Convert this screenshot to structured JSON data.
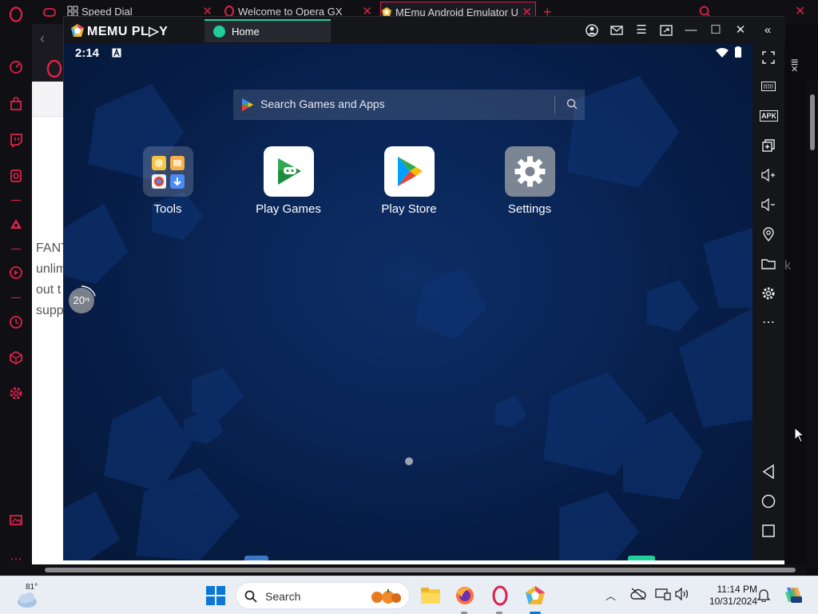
{
  "browser": {
    "tabs": [
      {
        "label": "Speed Dial"
      },
      {
        "label": "Welcome to Opera GX"
      },
      {
        "label": "MEmu Android Emulator U"
      }
    ],
    "page_text_fragments": [
      "FANT",
      "unlim",
      "out t",
      "supp"
    ],
    "page_text_right": "k"
  },
  "memu": {
    "logo": "MEMU PL▷Y",
    "home_tab": "Home",
    "status_time": "2:14",
    "search_placeholder": "Search Games and Apps",
    "apps": [
      {
        "label": "Tools"
      },
      {
        "label": "Play Games"
      },
      {
        "label": "Play Store"
      },
      {
        "label": "Settings"
      }
    ],
    "progress": "20",
    "progress_value": 20
  },
  "taskbar": {
    "weather_temp": "81°",
    "search_label": "Search",
    "time": "11:14 PM",
    "date": "10/31/2024"
  },
  "colors": {
    "opera_accent": "#e0204a",
    "memu_tab_accent": "#1fcf9a",
    "android_bg": "#0a2658"
  }
}
